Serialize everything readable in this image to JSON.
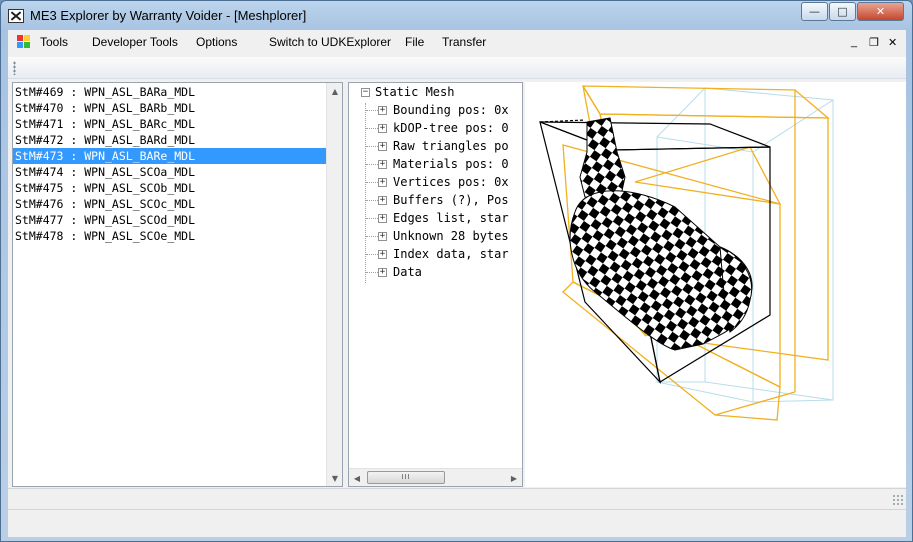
{
  "window": {
    "title": "ME3 Explorer by Warranty Voider - [Meshplorer]",
    "minimize_glyph": "—",
    "maximize_glyph": "□",
    "close_glyph": "✕"
  },
  "menu": {
    "items": [
      "Tools",
      "Developer Tools",
      "Options",
      "Switch to UDKExplorer",
      "File",
      "Transfer"
    ],
    "mdi_minimize": "_",
    "mdi_restore": "❐",
    "mdi_close": "✕"
  },
  "mesh_list": {
    "items": [
      "StM#469 : WPN_ASL_BARa_MDL",
      "StM#470 : WPN_ASL_BARb_MDL",
      "StM#471 : WPN_ASL_BARc_MDL",
      "StM#472 : WPN_ASL_BARd_MDL",
      "StM#473 : WPN_ASL_BARe_MDL",
      "StM#474 : WPN_ASL_SCOa_MDL",
      "StM#475 : WPN_ASL_SCOb_MDL",
      "StM#476 : WPN_ASL_SCOc_MDL",
      "StM#477 : WPN_ASL_SCOd_MDL",
      "StM#478 : WPN_ASL_SCOe_MDL"
    ],
    "selected_index": 4
  },
  "tree": {
    "root": "Static Mesh",
    "root_expander": "−",
    "children": [
      "Bounding pos: 0x",
      "kDOP-tree pos: 0",
      "Raw triangles po",
      "Materials pos: 0",
      "Vertices pos: 0x",
      "Buffers (?), Pos",
      "Edges list, star",
      "Unknown 28 bytes",
      "Index data, star",
      "Data"
    ],
    "child_expander": "+",
    "scroll_thumb_glyph": "III"
  },
  "scroll": {
    "up": "▲",
    "down": "▼",
    "left": "◀",
    "right": "▶"
  },
  "colors": {
    "selection": "#3399ff",
    "bbox_orange": "#f0b020",
    "bbox_light": "#b8dcea",
    "bbox_black": "#000000"
  }
}
